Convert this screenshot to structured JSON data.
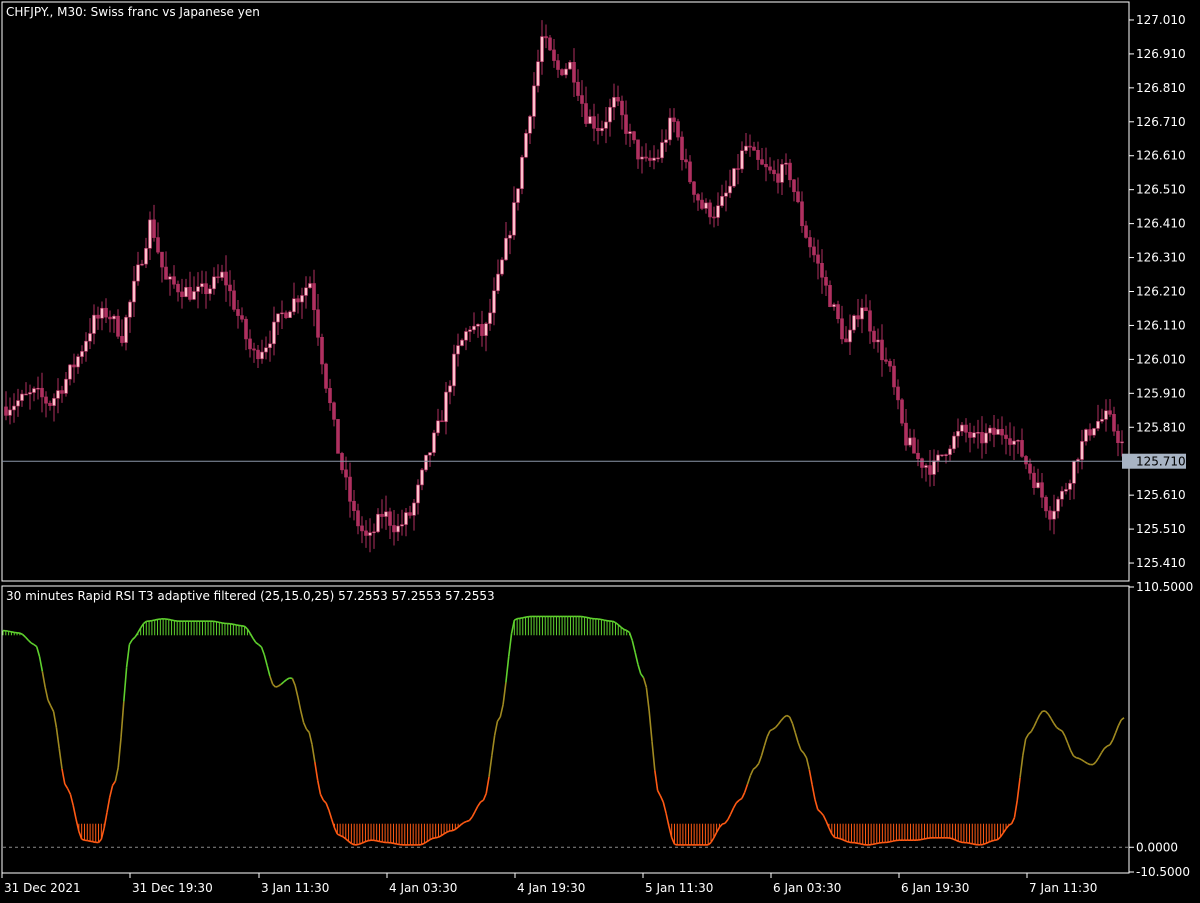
{
  "main_chart": {
    "title": "CHFJPY., M30:  Swiss franc vs Japanese yen",
    "current_price": "125.710",
    "candle_color": "#ffc0cb",
    "candle_edge": "#b03060",
    "price_labels": [
      "127.010",
      "126.910",
      "126.810",
      "126.710",
      "126.610",
      "126.510",
      "126.410",
      "126.310",
      "126.210",
      "126.110",
      "126.010",
      "125.910",
      "125.810",
      "125.610",
      "125.510",
      "125.410"
    ]
  },
  "indicator": {
    "title": "30 minutes Rapid RSI T3 adaptive filtered (25,15.0,25) 57.2553 57.2553 57.2553",
    "level_labels": [
      "110.5000",
      "0.0000",
      "-10.5000"
    ],
    "colors": {
      "up": "#5fd12e",
      "down": "#ff5a14",
      "mid": "#a08a20"
    }
  },
  "time_labels": [
    "31 Dec 2021",
    "31 Dec 19:30",
    "3 Jan 11:30",
    "4 Jan 03:30",
    "4 Jan 19:30",
    "5 Jan 11:30",
    "6 Jan 03:30",
    "6 Jan 19:30",
    "7 Jan 11:30"
  ],
  "chart_data": [
    {
      "type": "candlestick",
      "title": "CHFJPY., M30:  Swiss franc vs Japanese yen",
      "ylim": [
        125.36,
        127.06
      ],
      "x_tick_labels": [
        "31 Dec 2021",
        "31 Dec 19:30",
        "3 Jan 11:30",
        "4 Jan 03:30",
        "4 Jan 19:30",
        "5 Jan 11:30",
        "6 Jan 03:30",
        "6 Jan 19:30",
        "7 Jan 11:30"
      ],
      "close_path": [
        125.87,
        125.89,
        125.91,
        125.88,
        125.94,
        126.02,
        126.12,
        126.15,
        126.08,
        126.25,
        126.42,
        126.24,
        126.22,
        126.2,
        126.22,
        126.26,
        126.14,
        126.02,
        126.06,
        126.14,
        126.19,
        126.24,
        125.96,
        125.72,
        125.55,
        125.47,
        125.56,
        125.51,
        125.56,
        125.71,
        125.83,
        126.02,
        126.11,
        126.08,
        126.25,
        126.44,
        126.71,
        126.96,
        126.86,
        126.88,
        126.73,
        126.69,
        126.77,
        126.67,
        126.58,
        126.61,
        126.72,
        126.56,
        126.46,
        126.44,
        126.52,
        126.64,
        126.58,
        126.55,
        126.57,
        126.4,
        126.29,
        126.17,
        126.05,
        126.18,
        126.07,
        125.97,
        125.78,
        125.71,
        125.69,
        125.76,
        125.8,
        125.77,
        125.79,
        125.8,
        125.74,
        125.65,
        125.56,
        125.62,
        125.74,
        125.82,
        125.84,
        125.76
      ],
      "last_price": 125.71
    },
    {
      "type": "line",
      "title": "30 minutes Rapid RSI T3 adaptive filtered (25,15.0,25) 57.2553 57.2553 57.2553",
      "ylim": [
        -10.5,
        110.5
      ],
      "levels": [
        0.0
      ],
      "upper_threshold": 90,
      "lower_threshold": 10,
      "values": [
        92,
        91,
        86,
        60,
        25,
        3,
        2,
        28,
        88,
        96,
        97,
        96,
        96,
        96,
        95,
        94,
        86,
        68,
        72,
        50,
        20,
        5,
        1,
        3,
        2,
        1,
        1,
        4,
        7,
        11,
        20,
        55,
        97,
        98,
        98,
        98,
        98,
        97,
        96,
        92,
        72,
        22,
        1,
        1,
        1,
        10,
        20,
        34,
        50,
        56,
        40,
        15,
        4,
        2,
        1,
        2,
        3,
        3,
        4,
        4,
        2,
        1,
        3,
        10,
        48,
        58,
        50,
        38,
        35,
        43,
        55
      ],
      "last_value": 57.2553
    }
  ]
}
